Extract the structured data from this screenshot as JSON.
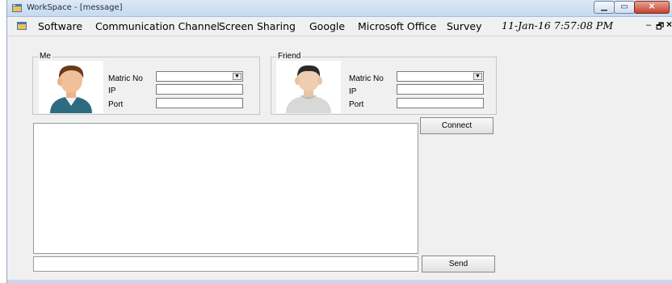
{
  "window": {
    "title": "WorkSpace - [message]"
  },
  "menu": {
    "items": [
      "Software",
      "Communication Channel",
      "Screen Sharing",
      "Google",
      "Microsoft Office",
      "Survey"
    ],
    "clock": "11-Jan-16 7:57:08 PM"
  },
  "me": {
    "group_label": "Me",
    "matric_label": "Matric No",
    "matric_value": "",
    "ip_label": "IP",
    "ip_value": "",
    "port_label": "Port",
    "port_value": ""
  },
  "friend": {
    "group_label": "Friend",
    "matric_label": "Matric No",
    "matric_value": "",
    "ip_label": "IP",
    "ip_value": "",
    "port_label": "Port",
    "port_value": ""
  },
  "buttons": {
    "connect": "Connect",
    "send": "Send"
  },
  "chat": {
    "log": "",
    "message": ""
  },
  "colors": {
    "titlebar": "#c6d9ee",
    "close": "#c4432c",
    "shirt_me": "#2d6b80",
    "hair_me": "#6b3a1a"
  }
}
